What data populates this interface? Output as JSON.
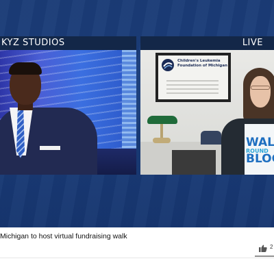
{
  "video": {
    "left_label": "KYZ STUDIOS",
    "right_label": "LIVE",
    "framed_sign": "Children's Leukemia Foundation of Michigan",
    "shirt_text": {
      "line1": "WAL",
      "line2": "ROUND",
      "line3": "BLOC"
    }
  },
  "caption": "Michigan to host virtual fundraising walk",
  "actions": {
    "like_count": "2",
    "like_icon": "thumbs-up-icon"
  },
  "colors": {
    "player_background": "#1a3d7a",
    "label_bar": "#132748",
    "like_bar": "#909090"
  }
}
